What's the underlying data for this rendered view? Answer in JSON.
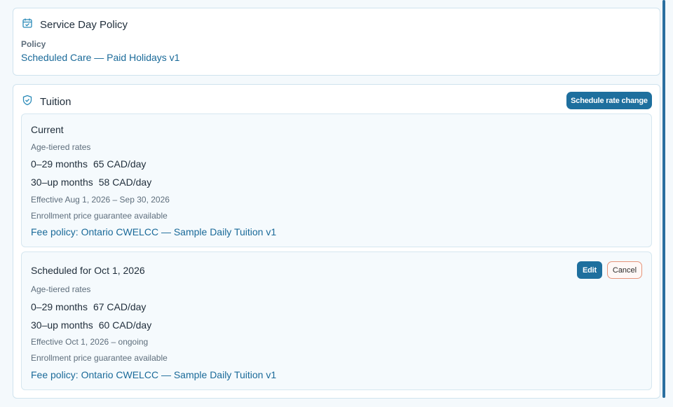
{
  "policy_card": {
    "title": "Service Day Policy",
    "label": "Policy",
    "value": "Scheduled Care — Paid Holidays v1"
  },
  "tuition_card": {
    "title": "Tuition",
    "schedule_button": "Schedule rate change",
    "current": {
      "heading": "Current",
      "rates_label": "Age-tiered rates",
      "tiers": [
        {
          "age": "0–29 months",
          "rate": "65 CAD/day"
        },
        {
          "age": "30–up months",
          "rate": "58 CAD/day"
        }
      ],
      "effective": "Effective Aug 1, 2026 – Sep 30, 2026",
      "guarantee": "Enrollment price guarantee available",
      "fee_policy": "Fee policy: Ontario CWELCC — Sample Daily Tuition v1"
    },
    "scheduled": {
      "heading": "Scheduled for Oct 1, 2026",
      "edit_button": "Edit",
      "cancel_button": "Cancel",
      "rates_label": "Age-tiered rates",
      "tiers": [
        {
          "age": "0–29 months",
          "rate": "67 CAD/day"
        },
        {
          "age": "30–up months",
          "rate": "60 CAD/day"
        }
      ],
      "effective": "Effective Oct 1, 2026 – ongoing",
      "guarantee": "Enrollment price guarantee available",
      "fee_policy": "Fee policy: Ontario CWELCC — Sample Daily Tuition v1"
    }
  },
  "colors": {
    "accent": "#1e6f9e",
    "link": "#1a6a99",
    "icon": "#2a8ab8",
    "cancel_border": "#e5947a"
  },
  "icons": {
    "policy": "calendar-check-icon",
    "tuition": "shield-check-icon"
  }
}
